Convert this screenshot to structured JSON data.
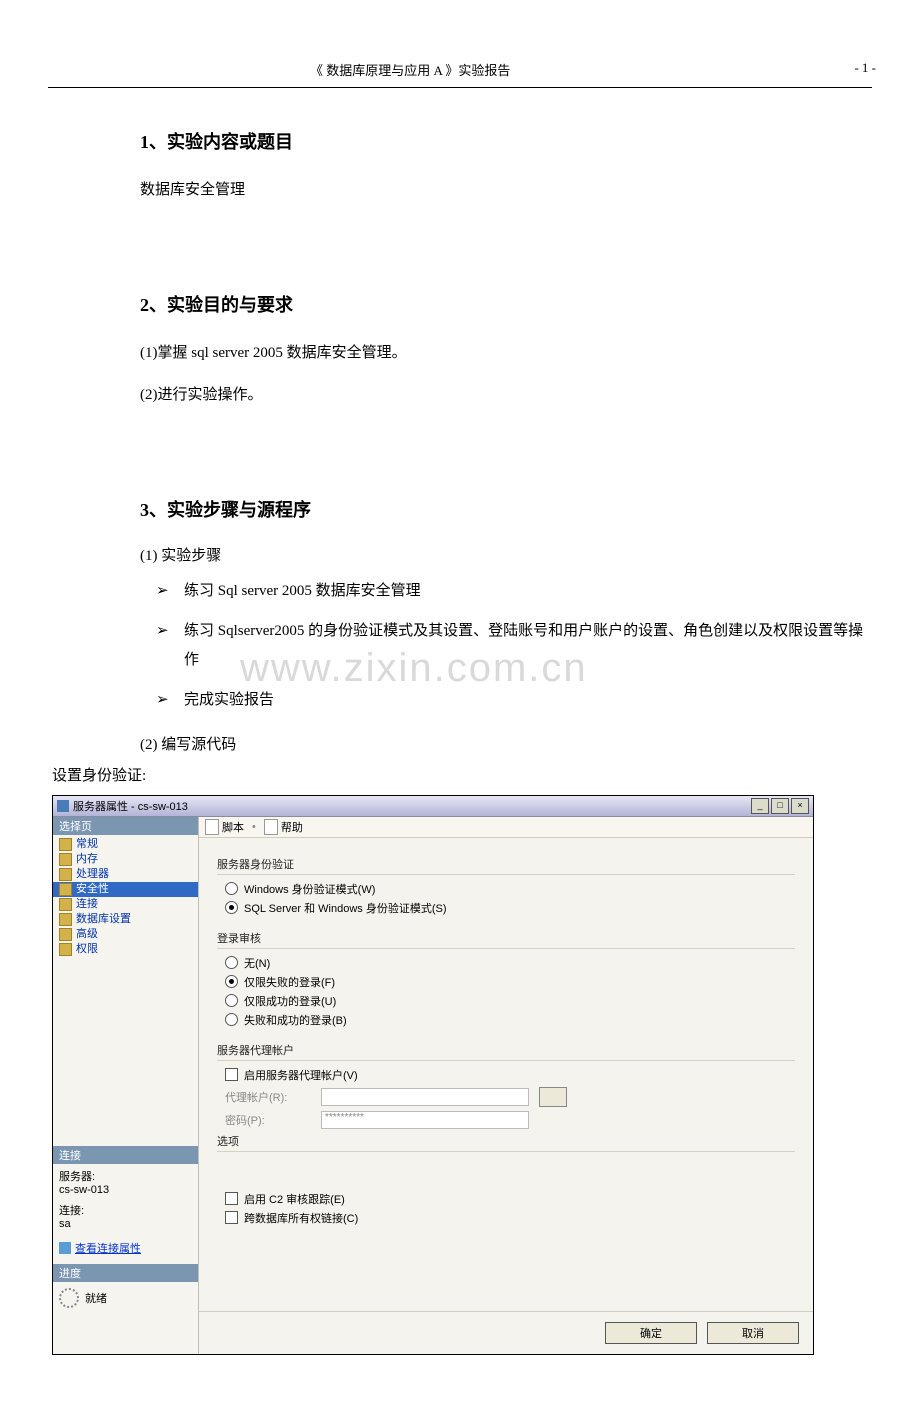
{
  "header": {
    "title": "《 数据库原理与应用 A 》实验报告",
    "page_no": "- 1 -"
  },
  "sections": {
    "s1": {
      "heading": "1、实验内容或题目",
      "body": "数据库安全管理"
    },
    "s2": {
      "heading": "2、实验目的与要求",
      "items": [
        "(1)掌握 sql server 2005 数据库安全管理。",
        "(2)进行实验操作。"
      ]
    },
    "s3": {
      "heading": "3、实验步骤与源程序",
      "step_label": "(1) 实验步骤",
      "bullets": [
        "练习 Sql server 2005 数据库安全管理",
        "练习 Sqlserver2005 的身份验证模式及其设置、登陆账号和用户账户的设置、角色创建以及权限设置等操作",
        "完成实验报告"
      ],
      "code_label": "(2) 编写源代码",
      "id_line": "设置身份验证:"
    }
  },
  "watermark": "www.zixin.com.cn",
  "dialog": {
    "title": "服务器属性 - cs-sw-013",
    "win_buttons": {
      "min": "_",
      "max": "□",
      "close": "×"
    },
    "sidebar": {
      "head1": "选择页",
      "nav": [
        "常规",
        "内存",
        "处理器",
        "安全性",
        "连接",
        "数据库设置",
        "高级",
        "权限"
      ],
      "selected_index": 3,
      "head2": "连接",
      "server_label": "服务器:",
      "server_value": "cs-sw-013",
      "conn_label": "连接:",
      "conn_value": "sa",
      "view_props": "查看连接属性",
      "head3": "进度",
      "status": "就绪"
    },
    "toolbar": {
      "script": "脚本",
      "help": "帮助"
    },
    "main": {
      "grp_auth": "服务器身份验证",
      "auth_opts": [
        {
          "label": "Windows 身份验证模式(W)",
          "checked": false
        },
        {
          "label": "SQL Server 和 Windows 身份验证模式(S)",
          "checked": true
        }
      ],
      "grp_audit": "登录审核",
      "audit_opts": [
        {
          "label": "无(N)",
          "checked": false
        },
        {
          "label": "仅限失败的登录(F)",
          "checked": true
        },
        {
          "label": "仅限成功的登录(U)",
          "checked": false
        },
        {
          "label": "失败和成功的登录(B)",
          "checked": false
        }
      ],
      "grp_proxy": "服务器代理帐户",
      "proxy_enable": "启用服务器代理帐户(V)",
      "proxy_account_label": "代理帐户(R):",
      "proxy_pwd_label": "密码(P):",
      "proxy_pwd_mask": "**********",
      "grp_options": "选项",
      "c2_label": "启用 C2 审核跟踪(E)",
      "chain_label": "跨数据库所有权链接(C)"
    },
    "footer": {
      "ok": "确定",
      "cancel": "取消"
    }
  }
}
